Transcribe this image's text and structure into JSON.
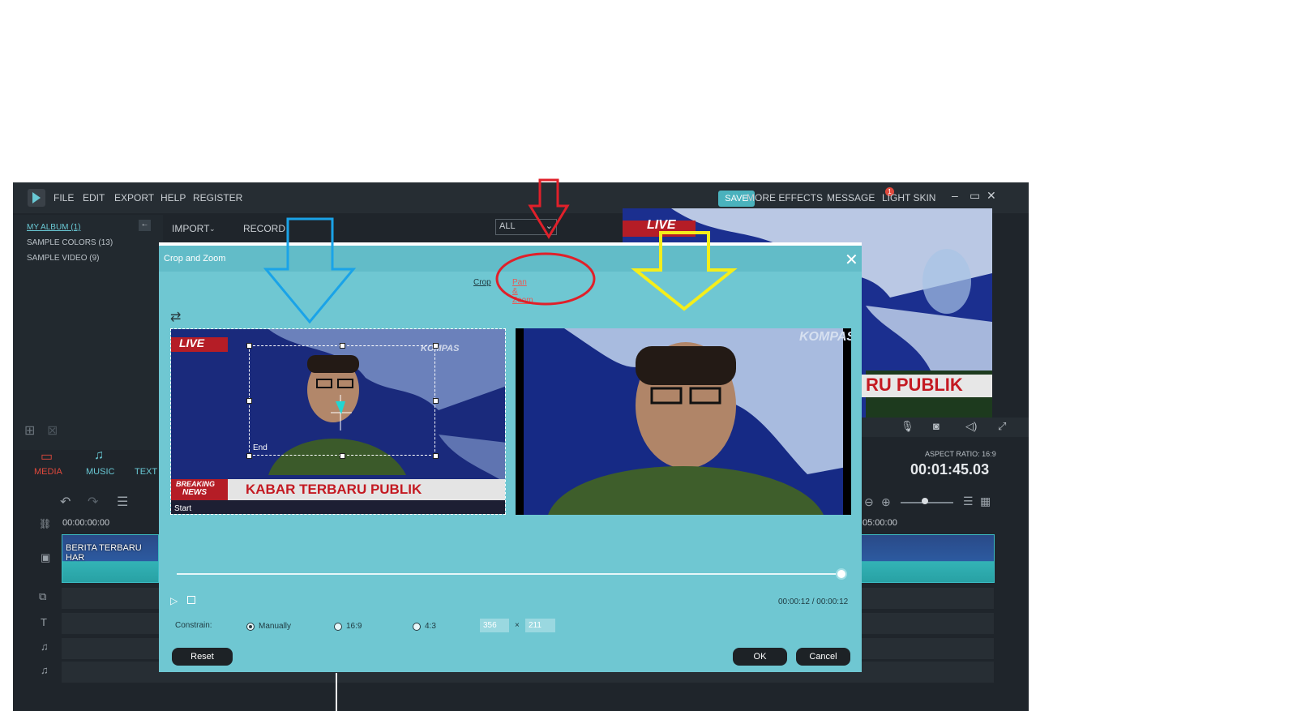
{
  "app": {
    "menu": [
      "FILE",
      "EDIT",
      "EXPORT",
      "HELP",
      "REGISTER"
    ],
    "save_label": "SAVE",
    "more_effects": "MORE EFFECTS",
    "message": "MESSAGE",
    "message_badge": "1",
    "light_skin": "LIGHT SKIN"
  },
  "album": {
    "items": [
      "MY ALBUM (1)",
      "SAMPLE COLORS (13)",
      "SAMPLE VIDEO (9)"
    ]
  },
  "media_toolbar": {
    "import": "IMPORT",
    "record": "RECORD",
    "filter": "ALL"
  },
  "media_tabs": [
    "MEDIA",
    "MUSIC",
    "TEXT"
  ],
  "preview": {
    "live_text": "LIVE",
    "banner_text": "RU PUBLIK",
    "aspect_ratio": "ASPECT RATIO: 16:9",
    "timecode": "00:01:45.03"
  },
  "timeline": {
    "start_time": "00:00:00:00",
    "end_time": "05:00:00",
    "clip_label": "BERITA TERBARU HAR"
  },
  "dialog": {
    "title": "Crop and Zoom",
    "tab_crop": "Crop",
    "tab_pan_zoom": "Pan & Zoom",
    "start_label": "Start",
    "end_label": "End",
    "live_text": "LIVE",
    "breaking": "BREAKING",
    "news": "NEWS",
    "headline": "KABAR TERBARU PUBLIK",
    "logo_text": "KOMPAS",
    "time": "00:00:12 / 00:00:12",
    "constrain_label": "Constrain:",
    "options": [
      "Manually",
      "16:9",
      "4:3"
    ],
    "width": "356",
    "times": "×",
    "height": "211",
    "reset": "Reset",
    "ok": "OK",
    "cancel": "Cancel"
  },
  "colors": {
    "accent": "#4ab2bd",
    "dialog_bg": "#6fc7d2",
    "annotation_red": "#e0202a",
    "annotation_blue": "#1aa3e8",
    "annotation_yellow": "#f5ee1a"
  }
}
